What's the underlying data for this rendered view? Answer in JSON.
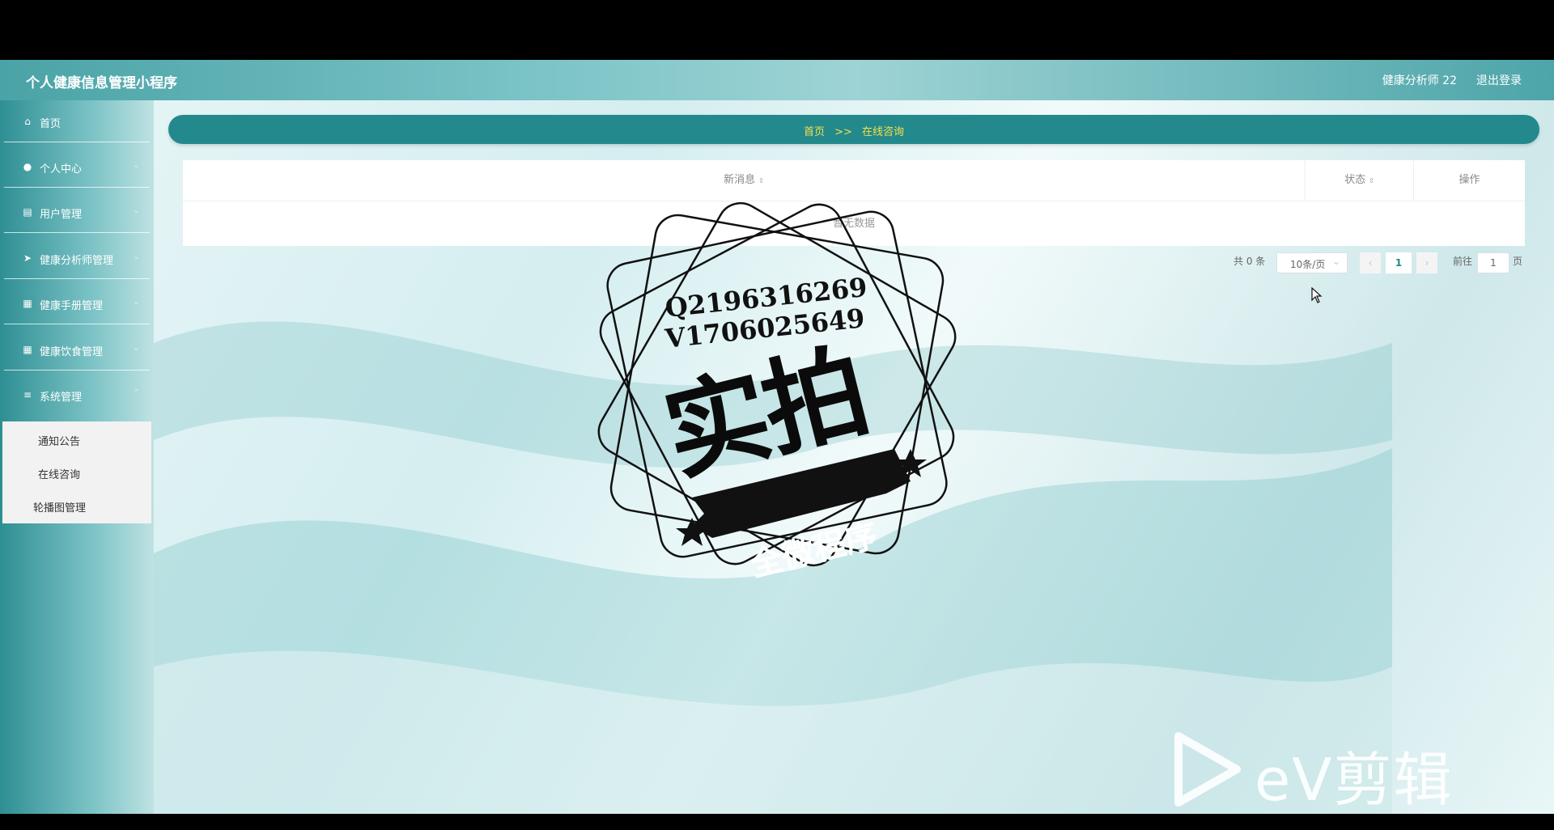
{
  "header": {
    "app_title": "个人健康信息管理小程序",
    "user_name": "健康分析师 22",
    "logout_label": "退出登录"
  },
  "sidebar": {
    "items": [
      {
        "label": "首页",
        "icon": "home-icon"
      },
      {
        "label": "个人中心",
        "icon": "user-icon"
      },
      {
        "label": "用户管理",
        "icon": "clipboard-icon"
      },
      {
        "label": "健康分析师管理",
        "icon": "send-icon"
      },
      {
        "label": "健康手册管理",
        "icon": "grid-icon"
      },
      {
        "label": "健康饮食管理",
        "icon": "grid-icon"
      },
      {
        "label": "系统管理",
        "icon": "list-icon"
      }
    ],
    "submenu": [
      "通知公告",
      "在线咨询",
      "轮播图管理"
    ]
  },
  "breadcrumb": {
    "home": "首页",
    "separator": ">>",
    "current": "在线咨询"
  },
  "table": {
    "columns": [
      "新消息",
      "状态",
      "操作"
    ],
    "empty_text": "暂无数据"
  },
  "pagination": {
    "total_text": "共 0 条",
    "page_size": "10条/页",
    "current_page": "1",
    "jump_label": "前往",
    "jump_value": "1",
    "page_suffix": "页"
  },
  "watermark": {
    "line1": "Q2196316269",
    "line2": "V1706025649",
    "big_text": "实拍",
    "ribbon_text": "全微程序",
    "ev_text": "eV剪辑"
  },
  "colors": {
    "accent": "#23898c",
    "crumb_text": "#f5e04a",
    "header": "#4aa3a6"
  }
}
